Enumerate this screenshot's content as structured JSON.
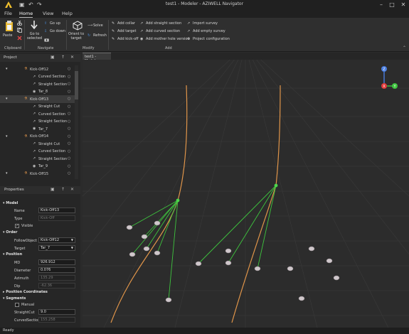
{
  "window": {
    "title": "test1 - Modeler - AZIWELL Navigator"
  },
  "menu": {
    "file": "File",
    "home": "Home",
    "view": "View",
    "help": "Help"
  },
  "ribbon": {
    "paste": "Paste",
    "go_to_selected": "Go to\nselected",
    "go_up": "Go up",
    "go_down": "Go down",
    "orient_to_target": "Orient to\ntarget",
    "solve": "Solve",
    "refresh": "Refresh",
    "add_collar": "Add collar",
    "add_target": "Add target",
    "add_kick_off": "Add kick-off",
    "add_straight_section": "Add straight section",
    "add_curved_section": "Add curved section",
    "add_mother_hole_version": "Add mother hole version",
    "import_survey": "Import survey",
    "add_empty_survey": "Add empty survey",
    "project_configuration": "Project configuration",
    "groups": {
      "clipboard": "Clipboard",
      "navigate": "Navigate",
      "modify": "Modify",
      "add": "Add"
    }
  },
  "project_panel": {
    "title": "Project",
    "items": [
      {
        "label": "Kick-Off12",
        "indent": 1,
        "icon": "kickoff-icon",
        "selected": false
      },
      {
        "label": "Curved Section",
        "indent": 2,
        "icon": "curved-section-icon",
        "selected": false
      },
      {
        "label": "Straight Section",
        "indent": 2,
        "icon": "straight-section-icon",
        "selected": false
      },
      {
        "label": "Tar_8",
        "indent": 2,
        "icon": "target-icon",
        "selected": false
      },
      {
        "label": "Kick-Off13",
        "indent": 1,
        "icon": "kickoff-icon",
        "selected": true
      },
      {
        "label": "Straight Cut",
        "indent": 2,
        "icon": "straight-section-icon",
        "selected": false
      },
      {
        "label": "Curved Section",
        "indent": 2,
        "icon": "curved-section-icon",
        "selected": false
      },
      {
        "label": "Straight Section",
        "indent": 2,
        "icon": "straight-section-icon",
        "selected": false
      },
      {
        "label": "Tar_7",
        "indent": 2,
        "icon": "target-icon",
        "selected": false
      },
      {
        "label": "Kick-Off14",
        "indent": 1,
        "icon": "kickoff-icon",
        "selected": false
      },
      {
        "label": "Straight Cut",
        "indent": 2,
        "icon": "straight-section-icon",
        "selected": false
      },
      {
        "label": "Curved Section",
        "indent": 2,
        "icon": "curved-section-icon",
        "selected": false
      },
      {
        "label": "Straight Section",
        "indent": 2,
        "icon": "straight-section-icon",
        "selected": false
      },
      {
        "label": "Tar_9",
        "indent": 2,
        "icon": "target-icon",
        "selected": false
      },
      {
        "label": "Kick-Off15",
        "indent": 1,
        "icon": "kickoff-icon",
        "selected": false
      }
    ]
  },
  "properties_panel": {
    "title": "Properties",
    "model_header": "Model",
    "name_label": "Name",
    "name_value": "Kick-Off13",
    "type_label": "Type",
    "type_value": "Kick-Off",
    "visible_label": "Visible",
    "order_header": "Order",
    "follow_object_label": "FollowObject",
    "follow_object_value": "Kick-Off12",
    "target_label": "Target",
    "target_value": "Tar_7",
    "position_header": "Position",
    "md_label": "MD",
    "md_value": "926.912",
    "diameter_label": "Diameter",
    "diameter_value": "0.076",
    "azimuth_label": "Azimuth",
    "azimuth_value": "135.29",
    "dip_label": "Dip",
    "dip_value": "-62.36",
    "position_coordinates_header": "Position Coordinates",
    "segments_header": "Segments",
    "manual_label": "Manual",
    "straight_cut_label": "StraightCut",
    "straight_cut_value": "9.0",
    "curved_section_label": "CurvedSection",
    "curved_section_value": "155.258"
  },
  "viewport": {
    "tab_label": "test1 - Modeler",
    "axis_x": "X",
    "axis_y": "Y",
    "axis_z": "Z",
    "colors": {
      "collar": "#e0954a",
      "kickoff": "#3ec43e",
      "target": "#cfc7cb",
      "grid": "#3a3a3a"
    }
  },
  "status": {
    "text": "Ready"
  }
}
